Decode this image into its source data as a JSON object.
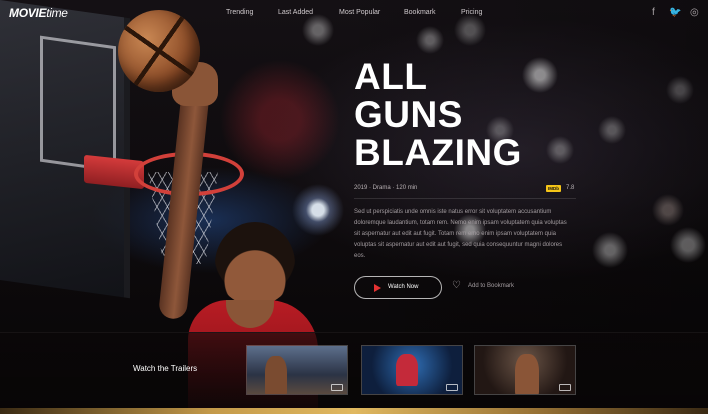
{
  "brand": {
    "logo_bold": "MOVIE",
    "logo_light": "time"
  },
  "nav": {
    "items": [
      {
        "label": "Trending"
      },
      {
        "label": "Last Added"
      },
      {
        "label": "Most Popular"
      },
      {
        "label": "Bookmark"
      },
      {
        "label": "Pricing"
      }
    ]
  },
  "social": [
    {
      "icon": "facebook-icon",
      "glyph": "f"
    },
    {
      "icon": "twitter-icon",
      "glyph": "🐦"
    },
    {
      "icon": "instagram-icon",
      "glyph": "◎"
    }
  ],
  "hero": {
    "title_lines": [
      "ALL",
      "GUNS",
      "BLAZING"
    ],
    "meta": "2019 · Drama · 120 min",
    "imdb_label": "IMDb",
    "rating": "7.8",
    "description": "Sed ut perspiciatis unde omnis iste natus error sit voluptatem accusantium doloremque laudantium, totam rem. Nemo enim ipsam voluptatem quia voluptas sit aspernatur aut edit aut fugit. Totam rem emo enim ipsam voluptatem quia voluptas sit aspernatur aut edit aut fugit, sed quia consequuntur magni dolores eos.",
    "watch_label": "Watch Now",
    "bookmark_label": "Add to Bookmark"
  },
  "trailers": {
    "label": "Watch the Trailers",
    "items": [
      {
        "name": "trailer-1"
      },
      {
        "name": "trailer-2"
      },
      {
        "name": "trailer-3"
      }
    ]
  },
  "colors": {
    "accent_red": "#e53232",
    "imdb_yellow": "#f5c518",
    "gold": "#c49a4a"
  }
}
